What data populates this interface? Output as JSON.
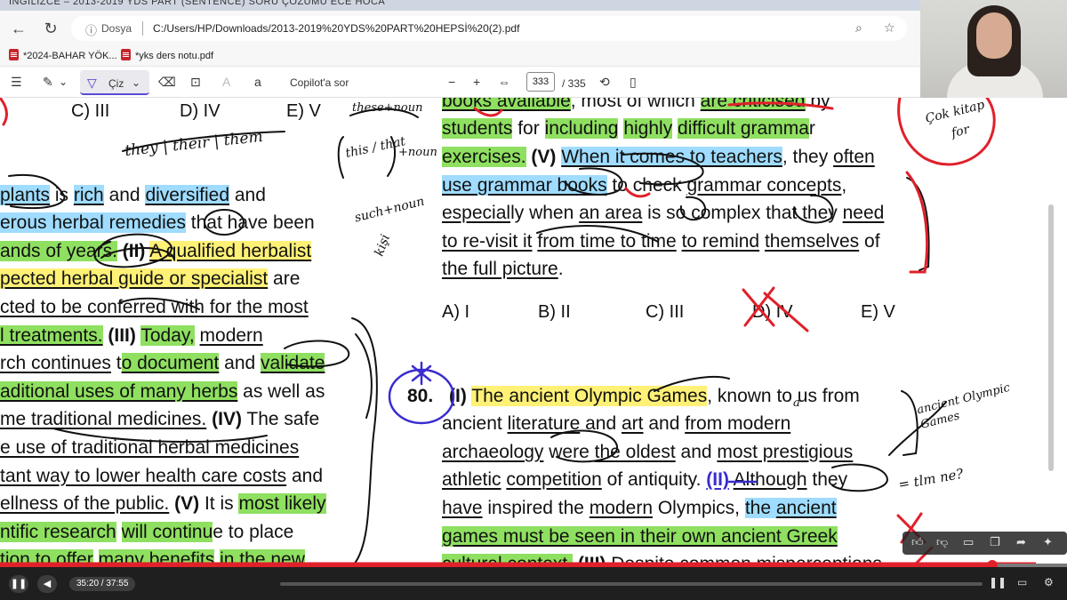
{
  "browser": {
    "tab_title": "İNGİLİZCE – 2013-2019 YDS PART (SENTENCE) SORU ÇÖZÜMÜ ECE HOCA",
    "tab_small": "2013-2019 YDS PART HEPSİ",
    "doc_label": "Dosya",
    "url": "C:/Users/HP/Downloads/2013-2019%20YDS%20PART%20HEPSİ%20(2).pdf",
    "bookmarks": [
      "*2024-BAHAR YÖK...",
      "*yks ders notu.pdf"
    ]
  },
  "pdf_toolbar": {
    "draw_label": "Çiz",
    "copilot_label": "Copilot'a sor",
    "zoom_out": "−",
    "zoom_in": "+",
    "page_current": "333",
    "page_total": "/ 335"
  },
  "left_column": {
    "options_top": [
      "C) III",
      "D) IV",
      "E) V"
    ],
    "lines": [
      "plants is rich and diversified and",
      "erous herbal remedies that have been",
      "ands of years. (II) A qualified herbalist",
      "pected herbal guide or specialist are",
      "cted to be conferred with for the most",
      "l treatments. (III) Today, modern",
      "rch continues to document and validate",
      "aditional uses of many herbs as well as",
      "me traditional medicines. (IV) The safe",
      "e use of traditional herbal medicines",
      "tant way to lower health care costs and",
      "ellness of the public. (V) It is most likely",
      "ntific research will continue to place",
      "tion to offer many benefits in the new"
    ]
  },
  "right_column": {
    "lines": [
      "books available, most of which are criticised by",
      "students for including highly difficult grammar",
      "exercises. (V) When it comes to teachers, they often",
      "use grammar books to check grammar concepts,",
      "especially when an area is so complex that they need",
      "to re-visit it from time to time to remind themselves of",
      "the full picture."
    ],
    "options": [
      "A) I",
      "B) II",
      "C) III",
      "D) IV",
      "E) V"
    ],
    "q80_number": "80.",
    "q80_lines": [
      "(I) The ancient Olympic Games, known to us from",
      "ancient literature and art and from modern",
      "archaeology were the oldest and most prestigious",
      "athletic competition of antiquity. (II) Although they",
      "have inspired the modern Olympics, the ancient",
      "games must be seen in their own ancient Greek",
      "cultural context. (III) Despite common misperceptions"
    ]
  },
  "handwriting": {
    "they_their": "they | their | them",
    "these_noun": "these+noun",
    "this_that": "this / that",
    "noun": "+noun",
    "such_noun": "such+noun",
    "kisi": "kişi",
    "gok_kitap": "Çok kitap",
    "for": "for",
    "ancient_olympic": "ancient Olympic Games",
    "them_ne": "= tlm ne?",
    "a_mark": "a"
  },
  "video": {
    "time": "35:20 / 37:55",
    "progress": 0.93
  },
  "colors": {
    "highlight_yellow": "#fff176",
    "highlight_green": "#8fe060",
    "highlight_blue": "#9fdcff",
    "ink_red": "#e0202a",
    "ink_purple": "#3a2ccf"
  }
}
